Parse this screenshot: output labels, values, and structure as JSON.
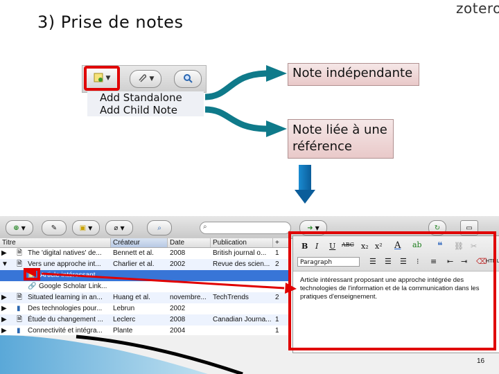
{
  "slide": {
    "title": "3) Prise de notes",
    "logo": "zotero",
    "page_number": "16"
  },
  "top_menu": {
    "items": [
      "Add Standalone Note",
      "Add Child Note"
    ]
  },
  "callouts": {
    "standalone": "Note indépendante",
    "child": "Note liée à une référence"
  },
  "table": {
    "columns": [
      "Titre",
      "Créateur",
      "Date",
      "Publication"
    ],
    "rows": [
      {
        "title": "The 'digital natives' de...",
        "creator": "Bennett et al.",
        "date": "2008",
        "publication": "British journal o...",
        "count": "1"
      },
      {
        "title": "Vers une approche int...",
        "creator": "Charlier et al.",
        "date": "2002",
        "publication": "Revue des scien...",
        "count": "2"
      },
      {
        "title": "Article intéressant ...",
        "creator": "",
        "date": "",
        "publication": "",
        "count": ""
      },
      {
        "title": "Google Scholar Link...",
        "creator": "",
        "date": "",
        "publication": "",
        "count": ""
      },
      {
        "title": "Situated learning in an...",
        "creator": "Huang et al.",
        "date": "novembre...",
        "publication": "TechTrends",
        "count": "2"
      },
      {
        "title": "Des technologies pour...",
        "creator": "Lebrun",
        "date": "2002",
        "publication": "",
        "count": ""
      },
      {
        "title": "Étude du changement ...",
        "creator": "Leclerc",
        "date": "2008",
        "publication": "Canadian Journa...",
        "count": "1"
      },
      {
        "title": "Connectivité et intégra...",
        "creator": "Plante",
        "date": "2004",
        "publication": "",
        "count": "1"
      }
    ]
  },
  "editor": {
    "format": "Paragraph",
    "html_label": "HTML",
    "text": "Article intéressant proposant une approche intégrée des technologies de l'information et de la communication dans les pratiques d'enseignement."
  }
}
